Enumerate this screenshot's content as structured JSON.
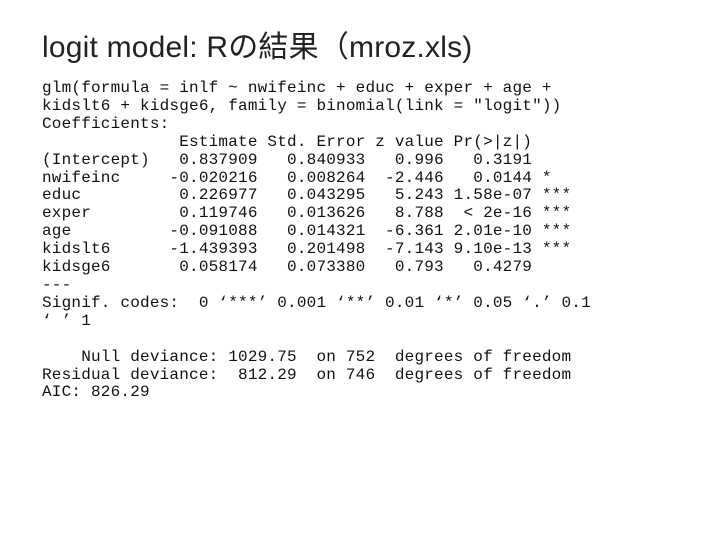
{
  "title": "logit model: Rの結果（mroz.xls)",
  "formula_line1": "glm(formula = inlf ~ nwifeinc + educ + exper + age +",
  "formula_line2": "kidslt6 + kidsge6, family = binomial(link = \"logit\"))",
  "coef_header": "Coefficients:",
  "col_h1": "Estimate",
  "col_h2": "Std. Error",
  "col_h3": "z value",
  "col_h4": "Pr(>|z|)",
  "rows": [
    {
      "name": "(Intercept)",
      "est": "0.837909",
      "se": "0.840933",
      "z": "0.996",
      "p": "0.3191",
      "sig": ""
    },
    {
      "name": "nwifeinc",
      "est": "-0.020216",
      "se": "0.008264",
      "z": "-2.446",
      "p": "0.0144",
      "sig": "*"
    },
    {
      "name": "educ",
      "est": "0.226977",
      "se": "0.043295",
      "z": "5.243",
      "p": "1.58e-07",
      "sig": "***"
    },
    {
      "name": "exper",
      "est": "0.119746",
      "se": "0.013626",
      "z": "8.788",
      "p": "< 2e-16",
      "sig": "***"
    },
    {
      "name": "age",
      "est": "-0.091088",
      "se": "0.014321",
      "z": "-6.361",
      "p": "2.01e-10",
      "sig": "***"
    },
    {
      "name": "kidslt6",
      "est": "-1.439393",
      "se": "0.201498",
      "z": "-7.143",
      "p": "9.10e-13",
      "sig": "***"
    },
    {
      "name": "kidsge6",
      "est": "0.058174",
      "se": "0.073380",
      "z": "0.793",
      "p": "0.4279",
      "sig": ""
    }
  ],
  "dash": "---",
  "signif_line1": "Signif. codes:  0 ‘***’ 0.001 ‘**’ 0.01 ‘*’ 0.05 ‘.’ 0.1",
  "signif_line2": "‘ ’ 1",
  "null_dev": "    Null deviance: 1029.75  on 752  degrees of freedom",
  "resid_dev": "Residual deviance:  812.29  on 746  degrees of freedom",
  "aic": "AIC: 826.29"
}
